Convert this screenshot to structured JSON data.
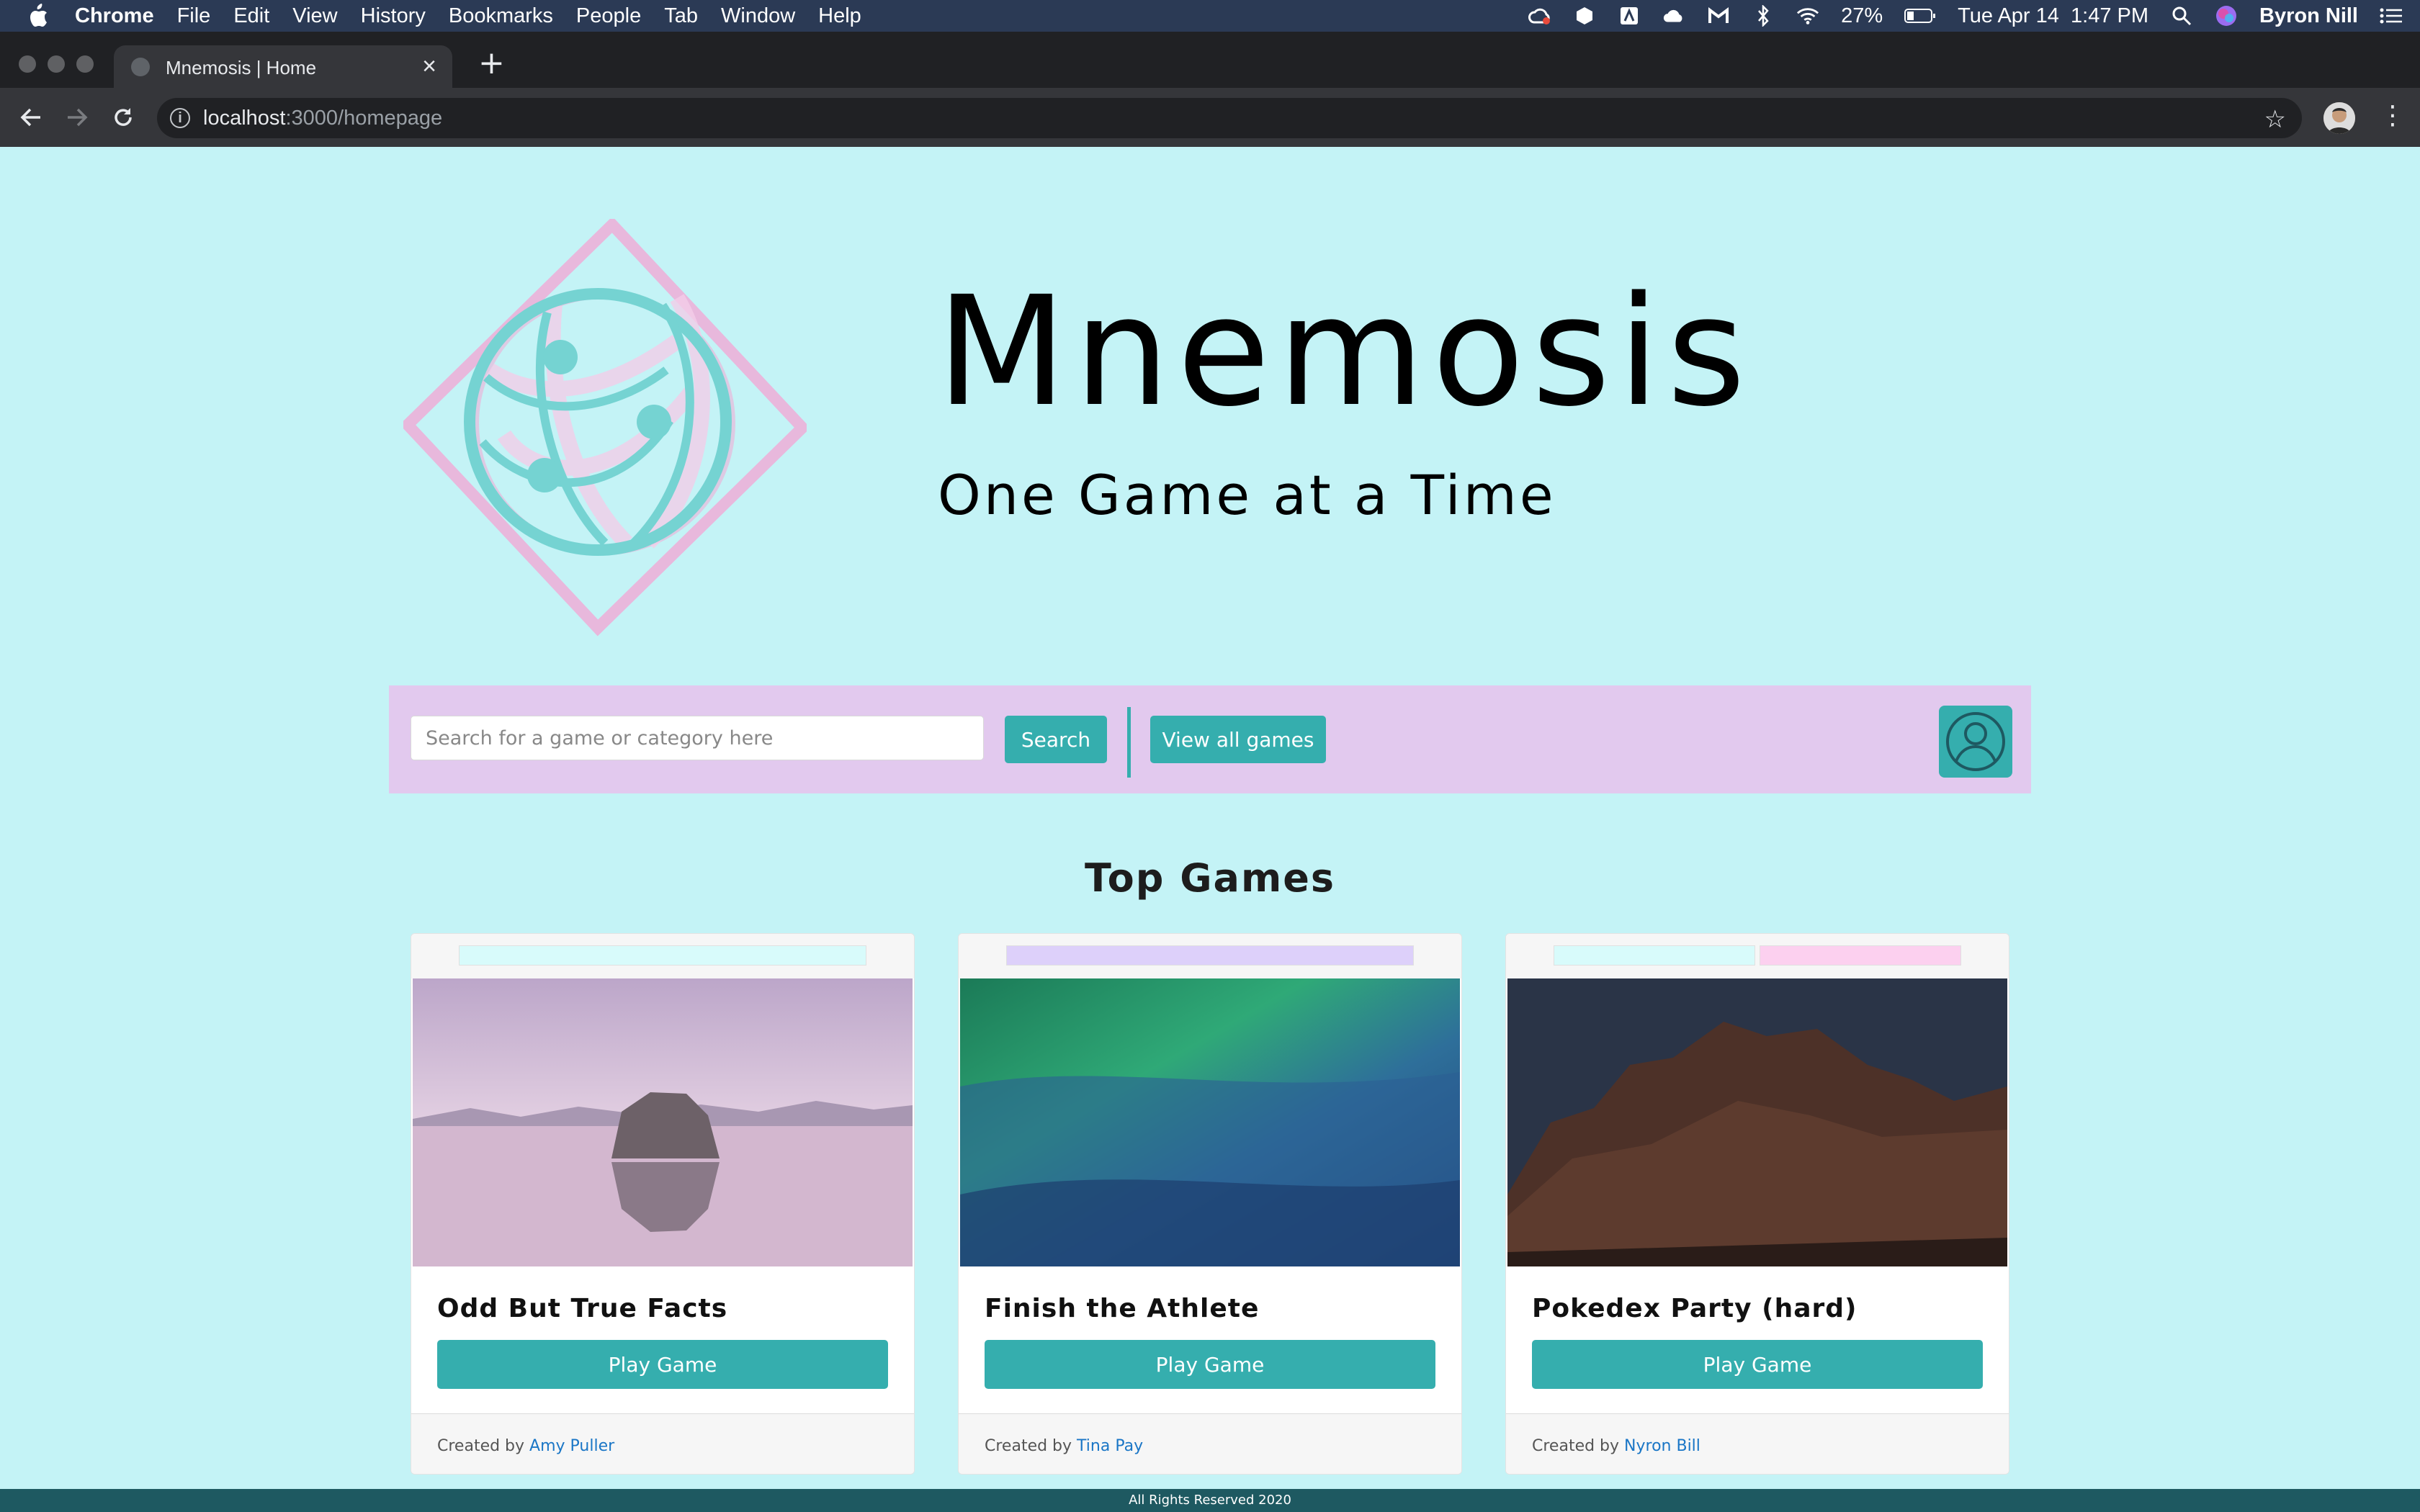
{
  "menubar": {
    "app": "Chrome",
    "items": [
      "File",
      "Edit",
      "View",
      "History",
      "Bookmarks",
      "People",
      "Tab",
      "Window",
      "Help"
    ],
    "battery": "27%",
    "datetime": "Tue Apr 14  1:47 PM",
    "user": "Byron Nill"
  },
  "browser": {
    "tab_title": "Mnemosis | Home",
    "url_host": "localhost",
    "url_path": ":3000/homepage"
  },
  "hero": {
    "title": "Mnemosis",
    "tagline": "One Game at a Time"
  },
  "search": {
    "placeholder": "Search for a game or category here",
    "search_label": "Search",
    "view_all_label": "View all games"
  },
  "section_title": "Top Games",
  "cards": [
    {
      "title": "Odd But True Facts",
      "button": "Play Game",
      "created_by": "Created by",
      "author": "Amy Puller"
    },
    {
      "title": "Finish the Athlete",
      "button": "Play Game",
      "created_by": "Created by",
      "author": "Tina Pay"
    },
    {
      "title": "Pokedex Party (hard)",
      "button": "Play Game",
      "created_by": "Created by",
      "author": "Nyron Bill"
    }
  ],
  "footer": "All Rights Reserved 2020",
  "colors": {
    "page_bg": "#c4f3f6",
    "accent": "#35aeae",
    "search_bar_bg": "#e2c9ee",
    "logo_pink": "#e8b8dc",
    "footer_bg": "#1e5961"
  }
}
